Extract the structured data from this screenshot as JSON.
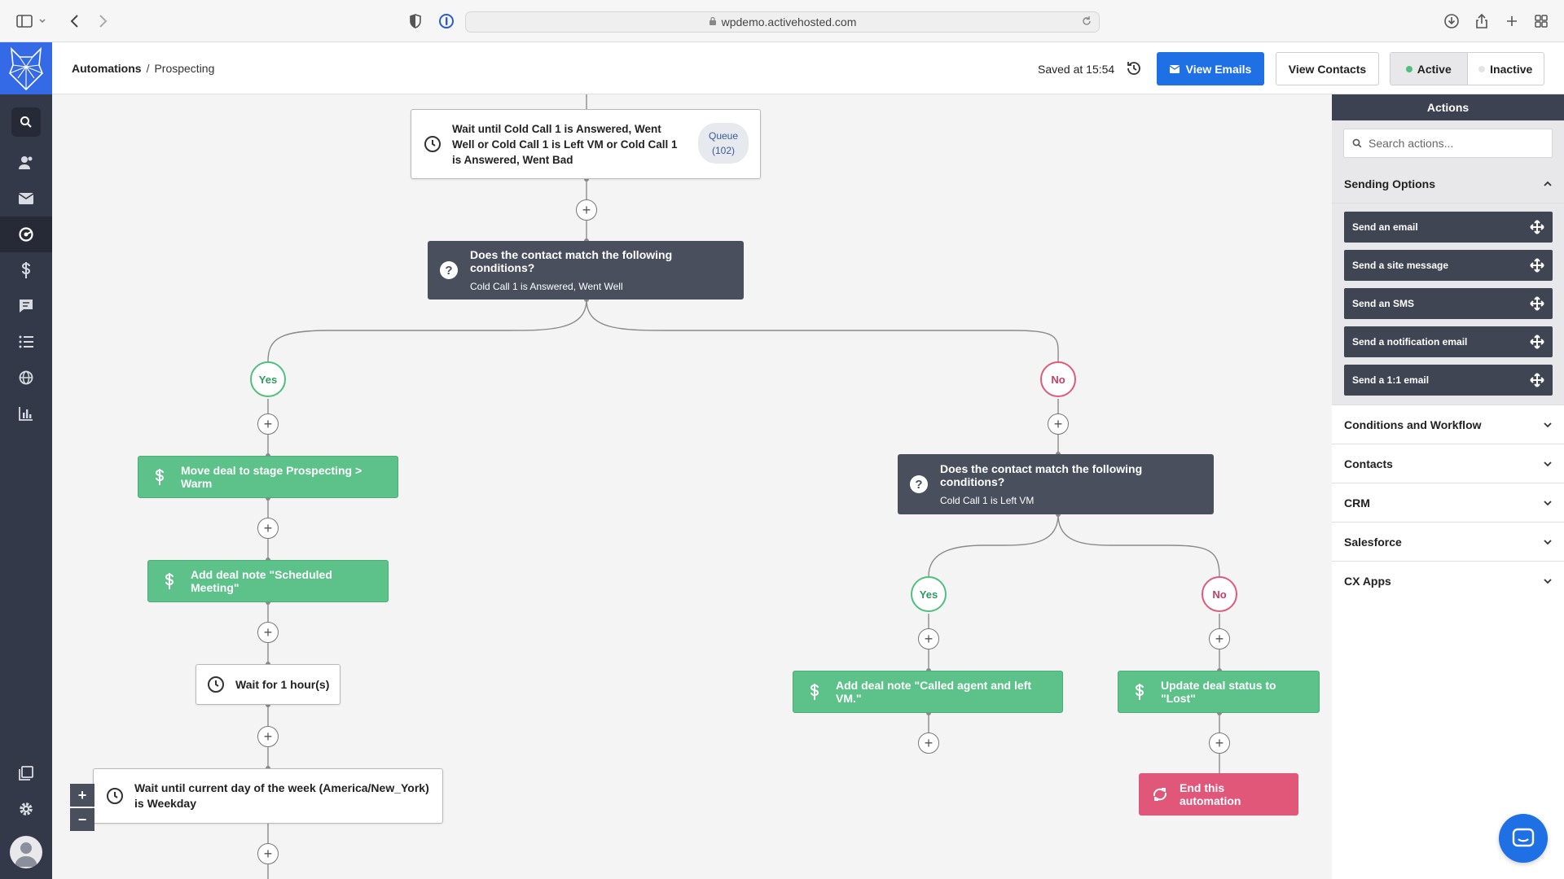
{
  "browser": {
    "url": "wpdemo.activehosted.com"
  },
  "header": {
    "breadcrumb_root": "Automations",
    "breadcrumb_sep": "/",
    "breadcrumb_current": "Prospecting",
    "saved": "Saved at 15:54",
    "view_emails": "View Emails",
    "view_contacts": "View Contacts",
    "active": "Active",
    "inactive": "Inactive"
  },
  "nodes": {
    "wait_answered": "Wait until Cold Call 1 is Answered, Went Well or Cold Call 1 is Left VM or Cold Call 1 is Answered, Went Bad",
    "queue_label": "Queue",
    "queue_count": "(102)",
    "cond1_title": "Does the contact match the following conditions?",
    "cond1_sub": "Cold Call 1 is Answered, Went Well",
    "yes": "Yes",
    "no": "No",
    "move_deal": "Move deal to stage Prospecting > Warm",
    "add_note_meeting": "Add deal note \"Scheduled Meeting\"",
    "wait_hour": "Wait for 1 hour(s)",
    "wait_weekday": "Wait until current day of the week (America/New_York) is Weekday",
    "cond2_title": "Does the contact match the following conditions?",
    "cond2_sub": "Cold Call 1 is Left VM",
    "add_note_vm": "Add deal note \"Called agent and left VM.\"",
    "update_status": "Update deal status to \"Lost\"",
    "end": "End this automation"
  },
  "panel": {
    "title": "Actions",
    "search_placeholder": "Search actions...",
    "sending_options": "Sending Options",
    "items": [
      "Send an email",
      "Send a site message",
      "Send an SMS",
      "Send a notification email",
      "Send a 1:1 email"
    ],
    "sections": [
      "Conditions and Workflow",
      "Contacts",
      "CRM",
      "Salesforce",
      "CX Apps"
    ]
  },
  "colors": {
    "primary": "#1f6fe5",
    "condition": "#4a4f5e",
    "deal": "#5cc289",
    "end": "#e0577a",
    "yes": "#4fbf7f",
    "no": "#dd5a7e",
    "active_dot": "#4fbf7f"
  }
}
